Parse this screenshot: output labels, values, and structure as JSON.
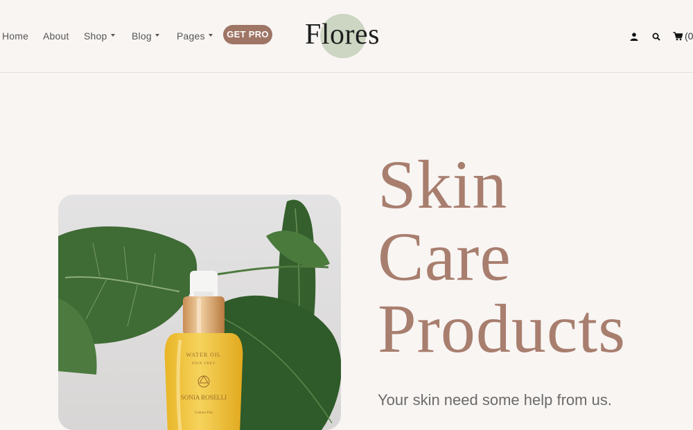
{
  "nav": {
    "items": [
      {
        "label": "Home",
        "dropdown": false
      },
      {
        "label": "About",
        "dropdown": false
      },
      {
        "label": "Shop",
        "dropdown": true
      },
      {
        "label": "Blog",
        "dropdown": true
      },
      {
        "label": "Pages",
        "dropdown": true
      }
    ],
    "cta_label": "GET PRO"
  },
  "brand": {
    "logo_text": "Flores",
    "logo_accent": "#ccd6c2"
  },
  "header_icons": {
    "user": "user-icon",
    "search": "search-icon",
    "cart": "cart-icon",
    "cart_count": "(0"
  },
  "hero": {
    "title_lines": [
      "Skin",
      "Care",
      "Products"
    ],
    "subtitle": "Your skin need some help from us.",
    "product_label": {
      "line1": "WATER OIL",
      "line2": "SOIN FREY",
      "brand": "SONIA ROSELLI",
      "line3": "Contour Fins"
    }
  },
  "colors": {
    "background": "#f8f5f3",
    "accent": "#9f7565",
    "title": "#a87e6e",
    "leaf": "#3f6b35"
  }
}
